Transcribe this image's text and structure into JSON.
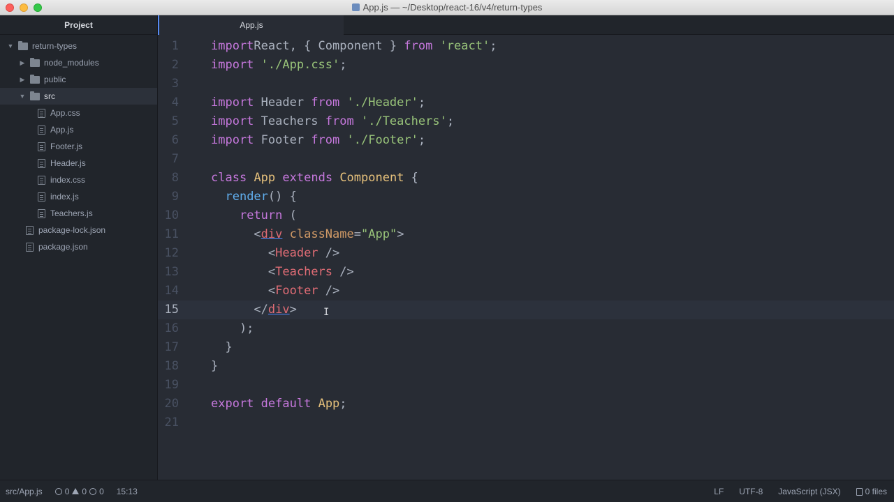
{
  "window": {
    "title": "App.js — ~/Desktop/react-16/v4/return-types"
  },
  "sidebar": {
    "header": "Project",
    "items": [
      {
        "label": "return-types",
        "type": "folder",
        "expanded": true,
        "depth": 0
      },
      {
        "label": "node_modules",
        "type": "folder",
        "expanded": false,
        "depth": 1
      },
      {
        "label": "public",
        "type": "folder",
        "expanded": false,
        "depth": 1
      },
      {
        "label": "src",
        "type": "folder",
        "expanded": true,
        "depth": 1,
        "selected": true
      },
      {
        "label": "App.css",
        "type": "file",
        "depth": 2
      },
      {
        "label": "App.js",
        "type": "file",
        "depth": 2
      },
      {
        "label": "Footer.js",
        "type": "file",
        "depth": 2
      },
      {
        "label": "Header.js",
        "type": "file",
        "depth": 2
      },
      {
        "label": "index.css",
        "type": "file",
        "depth": 2
      },
      {
        "label": "index.js",
        "type": "file",
        "depth": 2
      },
      {
        "label": "Teachers.js",
        "type": "file",
        "depth": 2
      },
      {
        "label": "package-lock.json",
        "type": "file",
        "depth": 1
      },
      {
        "label": "package.json",
        "type": "file",
        "depth": 1
      }
    ]
  },
  "tabs": [
    {
      "label": "App.js",
      "active": true
    }
  ],
  "editor": {
    "current_line": 15,
    "lines": [
      {
        "n": "1",
        "tokens": [
          [
            "kw",
            "import"
          ],
          [
            "",
            "React, { Component } "
          ],
          [
            "kw",
            "from"
          ],
          [
            "",
            " "
          ],
          [
            "str",
            "'react'"
          ],
          [
            "",
            ";"
          ]
        ]
      },
      {
        "n": "2",
        "tokens": [
          [
            "kw",
            "import"
          ],
          [
            "",
            " "
          ],
          [
            "str",
            "'./App.css'"
          ],
          [
            "",
            ";"
          ]
        ]
      },
      {
        "n": "3",
        "tokens": []
      },
      {
        "n": "4",
        "tokens": [
          [
            "kw",
            "import"
          ],
          [
            "",
            " Header "
          ],
          [
            "kw",
            "from"
          ],
          [
            "",
            " "
          ],
          [
            "str",
            "'./Header'"
          ],
          [
            "",
            ";"
          ]
        ]
      },
      {
        "n": "5",
        "tokens": [
          [
            "kw",
            "import"
          ],
          [
            "",
            " Teachers "
          ],
          [
            "kw",
            "from"
          ],
          [
            "",
            " "
          ],
          [
            "str",
            "'./Teachers'"
          ],
          [
            "",
            ";"
          ]
        ]
      },
      {
        "n": "6",
        "tokens": [
          [
            "kw",
            "import"
          ],
          [
            "",
            " Footer "
          ],
          [
            "kw",
            "from"
          ],
          [
            "",
            " "
          ],
          [
            "str",
            "'./Footer'"
          ],
          [
            "",
            ";"
          ]
        ]
      },
      {
        "n": "7",
        "tokens": []
      },
      {
        "n": "8",
        "tokens": [
          [
            "kw",
            "class"
          ],
          [
            "",
            " "
          ],
          [
            "cls",
            "App"
          ],
          [
            "",
            " "
          ],
          [
            "kw",
            "extends"
          ],
          [
            "",
            " "
          ],
          [
            "cls",
            "Component"
          ],
          [
            "",
            " {"
          ]
        ]
      },
      {
        "n": "9",
        "tokens": [
          [
            "",
            "  "
          ],
          [
            "fn",
            "render"
          ],
          [
            "",
            "() {"
          ]
        ]
      },
      {
        "n": "10",
        "tokens": [
          [
            "",
            "    "
          ],
          [
            "kw",
            "return"
          ],
          [
            "",
            " ("
          ]
        ]
      },
      {
        "n": "11",
        "tokens": [
          [
            "",
            "      <"
          ],
          [
            "tag ul",
            "div"
          ],
          [
            "",
            " "
          ],
          [
            "attr",
            "className"
          ],
          [
            "",
            "="
          ],
          [
            "str",
            "\"App\""
          ],
          [
            "",
            ">"
          ]
        ]
      },
      {
        "n": "12",
        "tokens": [
          [
            "",
            "        <"
          ],
          [
            "tag",
            "Header"
          ],
          [
            "",
            " />"
          ]
        ]
      },
      {
        "n": "13",
        "tokens": [
          [
            "",
            "        <"
          ],
          [
            "tag",
            "Teachers"
          ],
          [
            "",
            " />"
          ]
        ]
      },
      {
        "n": "14",
        "tokens": [
          [
            "",
            "        <"
          ],
          [
            "tag",
            "Footer"
          ],
          [
            "",
            " />"
          ]
        ]
      },
      {
        "n": "15",
        "tokens": [
          [
            "",
            "      </"
          ],
          [
            "tag ul",
            "div"
          ],
          [
            "",
            ">"
          ]
        ]
      },
      {
        "n": "16",
        "tokens": [
          [
            "",
            "    );"
          ]
        ]
      },
      {
        "n": "17",
        "tokens": [
          [
            "",
            "  }"
          ]
        ]
      },
      {
        "n": "18",
        "tokens": [
          [
            "",
            "}"
          ]
        ]
      },
      {
        "n": "19",
        "tokens": []
      },
      {
        "n": "20",
        "tokens": [
          [
            "kw",
            "export"
          ],
          [
            "",
            " "
          ],
          [
            "kw",
            "default"
          ],
          [
            "",
            " "
          ],
          [
            "cls",
            "App"
          ],
          [
            "",
            ";"
          ]
        ]
      },
      {
        "n": "21",
        "tokens": []
      }
    ]
  },
  "statusbar": {
    "path": "src/App.js",
    "errors": "0",
    "warnings": "0",
    "infos": "0",
    "cursor_pos": "15:13",
    "line_ending": "LF",
    "encoding": "UTF-8",
    "grammar": "JavaScript (JSX)",
    "files": "0 files"
  },
  "colors": {
    "keyword": "#c678dd",
    "string": "#98c379",
    "class": "#e5c07b",
    "function": "#61afef",
    "tag": "#e06c75",
    "attribute": "#d19a66",
    "background": "#282c34"
  }
}
